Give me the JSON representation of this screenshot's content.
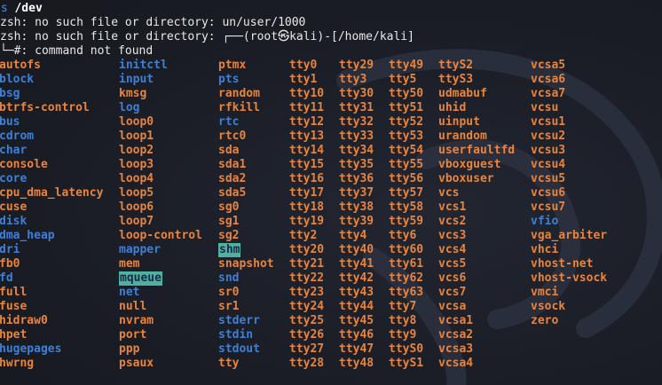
{
  "terminal": {
    "prompt_line": {
      "command": "ls",
      "argument": "/dev"
    },
    "output_lines": [
      "zsh: no such file or directory: un/user/1000",
      "zsh: no such file or directory: ┌──(root㉿kali)-[/home/kali]",
      "└─#: command not found"
    ]
  },
  "listing": {
    "rows": [
      [
        [
          "autofs",
          "dev"
        ],
        [
          "initctl",
          "dir"
        ],
        [
          "ptmx",
          "dev"
        ],
        [
          "tty0",
          "dev"
        ],
        [
          "tty29",
          "dev"
        ],
        [
          "tty49",
          "dev"
        ],
        [
          "ttyS2",
          "dev"
        ],
        [
          "vcsa5",
          "dev"
        ]
      ],
      [
        [
          "block",
          "dir"
        ],
        [
          "input",
          "dir"
        ],
        [
          "pts",
          "dir"
        ],
        [
          "tty1",
          "dev"
        ],
        [
          "tty3",
          "dev"
        ],
        [
          "tty5",
          "dev"
        ],
        [
          "ttyS3",
          "dev"
        ],
        [
          "vcsa6",
          "dev"
        ]
      ],
      [
        [
          "bsg",
          "dir"
        ],
        [
          "kmsg",
          "dev"
        ],
        [
          "random",
          "dev"
        ],
        [
          "tty10",
          "dev"
        ],
        [
          "tty30",
          "dev"
        ],
        [
          "tty50",
          "dev"
        ],
        [
          "udmabuf",
          "dev"
        ],
        [
          "vcsa7",
          "dev"
        ]
      ],
      [
        [
          "btrfs-control",
          "dev"
        ],
        [
          "log",
          "dir"
        ],
        [
          "rfkill",
          "dev"
        ],
        [
          "tty11",
          "dev"
        ],
        [
          "tty31",
          "dev"
        ],
        [
          "tty51",
          "dev"
        ],
        [
          "uhid",
          "dev"
        ],
        [
          "vcsu",
          "dev"
        ]
      ],
      [
        [
          "bus",
          "dir"
        ],
        [
          "loop0",
          "dev"
        ],
        [
          "rtc",
          "dir"
        ],
        [
          "tty12",
          "dev"
        ],
        [
          "tty32",
          "dev"
        ],
        [
          "tty52",
          "dev"
        ],
        [
          "uinput",
          "dev"
        ],
        [
          "vcsu1",
          "dev"
        ]
      ],
      [
        [
          "cdrom",
          "dir"
        ],
        [
          "loop1",
          "dev"
        ],
        [
          "rtc0",
          "dev"
        ],
        [
          "tty13",
          "dev"
        ],
        [
          "tty33",
          "dev"
        ],
        [
          "tty53",
          "dev"
        ],
        [
          "urandom",
          "dev"
        ],
        [
          "vcsu2",
          "dev"
        ]
      ],
      [
        [
          "char",
          "dir"
        ],
        [
          "loop2",
          "dev"
        ],
        [
          "sda",
          "dev"
        ],
        [
          "tty14",
          "dev"
        ],
        [
          "tty34",
          "dev"
        ],
        [
          "tty54",
          "dev"
        ],
        [
          "userfaultfd",
          "dev"
        ],
        [
          "vcsu3",
          "dev"
        ]
      ],
      [
        [
          "console",
          "dev"
        ],
        [
          "loop3",
          "dev"
        ],
        [
          "sda1",
          "dev"
        ],
        [
          "tty15",
          "dev"
        ],
        [
          "tty35",
          "dev"
        ],
        [
          "tty55",
          "dev"
        ],
        [
          "vboxguest",
          "dev"
        ],
        [
          "vcsu4",
          "dev"
        ]
      ],
      [
        [
          "core",
          "dir"
        ],
        [
          "loop4",
          "dev"
        ],
        [
          "sda2",
          "dev"
        ],
        [
          "tty16",
          "dev"
        ],
        [
          "tty36",
          "dev"
        ],
        [
          "tty56",
          "dev"
        ],
        [
          "vboxuser",
          "dev"
        ],
        [
          "vcsu5",
          "dev"
        ]
      ],
      [
        [
          "cpu_dma_latency",
          "dev"
        ],
        [
          "loop5",
          "dev"
        ],
        [
          "sda5",
          "dev"
        ],
        [
          "tty17",
          "dev"
        ],
        [
          "tty37",
          "dev"
        ],
        [
          "tty57",
          "dev"
        ],
        [
          "vcs",
          "dev"
        ],
        [
          "vcsu6",
          "dev"
        ]
      ],
      [
        [
          "cuse",
          "dev"
        ],
        [
          "loop6",
          "dev"
        ],
        [
          "sg0",
          "dev"
        ],
        [
          "tty18",
          "dev"
        ],
        [
          "tty38",
          "dev"
        ],
        [
          "tty58",
          "dev"
        ],
        [
          "vcs1",
          "dev"
        ],
        [
          "vcsu7",
          "dev"
        ]
      ],
      [
        [
          "disk",
          "dir"
        ],
        [
          "loop7",
          "dev"
        ],
        [
          "sg1",
          "dev"
        ],
        [
          "tty19",
          "dev"
        ],
        [
          "tty39",
          "dev"
        ],
        [
          "tty59",
          "dev"
        ],
        [
          "vcs2",
          "dev"
        ],
        [
          "vfio",
          "dir"
        ]
      ],
      [
        [
          "dma_heap",
          "dir"
        ],
        [
          "loop-control",
          "dev"
        ],
        [
          "sg2",
          "dev"
        ],
        [
          "tty2",
          "dev"
        ],
        [
          "tty4",
          "dev"
        ],
        [
          "tty6",
          "dev"
        ],
        [
          "vcs3",
          "dev"
        ],
        [
          "vga_arbiter",
          "dev"
        ]
      ],
      [
        [
          "dri",
          "dir"
        ],
        [
          "mapper",
          "dir"
        ],
        [
          "shm",
          "hl"
        ],
        [
          "tty20",
          "dev"
        ],
        [
          "tty40",
          "dev"
        ],
        [
          "tty60",
          "dev"
        ],
        [
          "vcs4",
          "dev"
        ],
        [
          "vhci",
          "dev"
        ]
      ],
      [
        [
          "fb0",
          "dev"
        ],
        [
          "mem",
          "dev"
        ],
        [
          "snapshot",
          "dev"
        ],
        [
          "tty21",
          "dev"
        ],
        [
          "tty41",
          "dev"
        ],
        [
          "tty61",
          "dev"
        ],
        [
          "vcs5",
          "dev"
        ],
        [
          "vhost-net",
          "dev"
        ]
      ],
      [
        [
          "fd",
          "dir"
        ],
        [
          "mqueue",
          "hl"
        ],
        [
          "snd",
          "dir"
        ],
        [
          "tty22",
          "dev"
        ],
        [
          "tty42",
          "dev"
        ],
        [
          "tty62",
          "dev"
        ],
        [
          "vcs6",
          "dev"
        ],
        [
          "vhost-vsock",
          "dev"
        ]
      ],
      [
        [
          "full",
          "dev"
        ],
        [
          "net",
          "dir"
        ],
        [
          "sr0",
          "dev"
        ],
        [
          "tty23",
          "dev"
        ],
        [
          "tty43",
          "dev"
        ],
        [
          "tty63",
          "dev"
        ],
        [
          "vcs7",
          "dev"
        ],
        [
          "vmci",
          "dev"
        ]
      ],
      [
        [
          "fuse",
          "dev"
        ],
        [
          "null",
          "dev"
        ],
        [
          "sr1",
          "dev"
        ],
        [
          "tty24",
          "dev"
        ],
        [
          "tty44",
          "dev"
        ],
        [
          "tty7",
          "dev"
        ],
        [
          "vcsa",
          "dev"
        ],
        [
          "vsock",
          "dev"
        ]
      ],
      [
        [
          "hidraw0",
          "dev"
        ],
        [
          "nvram",
          "dev"
        ],
        [
          "stderr",
          "dir"
        ],
        [
          "tty25",
          "dev"
        ],
        [
          "tty45",
          "dev"
        ],
        [
          "tty8",
          "dev"
        ],
        [
          "vcsa1",
          "dev"
        ],
        [
          "zero",
          "dev"
        ]
      ],
      [
        [
          "hpet",
          "dev"
        ],
        [
          "port",
          "dev"
        ],
        [
          "stdin",
          "dir"
        ],
        [
          "tty26",
          "dev"
        ],
        [
          "tty46",
          "dev"
        ],
        [
          "tty9",
          "dev"
        ],
        [
          "vcsa2",
          "dev"
        ]
      ],
      [
        [
          "hugepages",
          "dir"
        ],
        [
          "ppp",
          "dev"
        ],
        [
          "stdout",
          "dir"
        ],
        [
          "tty27",
          "dev"
        ],
        [
          "tty47",
          "dev"
        ],
        [
          "ttyS0",
          "dev"
        ],
        [
          "vcsa3",
          "dev"
        ]
      ],
      [
        [
          "hwrng",
          "dev"
        ],
        [
          "psaux",
          "dev"
        ],
        [
          "tty",
          "dev"
        ],
        [
          "tty28",
          "dev"
        ],
        [
          "tty48",
          "dev"
        ],
        [
          "ttyS1",
          "dev"
        ],
        [
          "vcsa4",
          "dev"
        ]
      ]
    ]
  },
  "colors": {
    "background": "#1b1e26",
    "directory": "#3f7fd6",
    "device": "#e8843c",
    "highlight_bg": "#4fb1a0",
    "text": "#e8e8e8"
  },
  "icons": {
    "background_watermark": "kali-dragon-icon"
  }
}
